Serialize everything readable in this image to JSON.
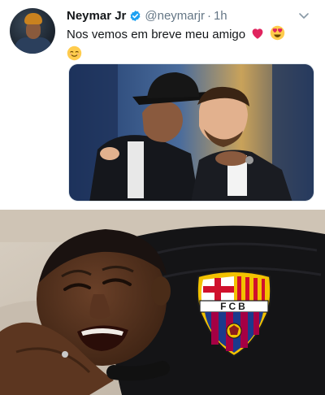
{
  "tweet": {
    "author_name": "Neymar Jr",
    "verified_icon": "verified-badge-icon",
    "handle": "@neymarjr",
    "separator": "·",
    "time": "1h",
    "text": "Nos vemos em breve meu amigo",
    "emojis": [
      "red-heart",
      "heart-eyes",
      "relieved-face"
    ],
    "menu_icon": "chevron-down-icon",
    "accent_color": "#1da1f2"
  },
  "meme": {
    "badge_letters": "FCB"
  }
}
